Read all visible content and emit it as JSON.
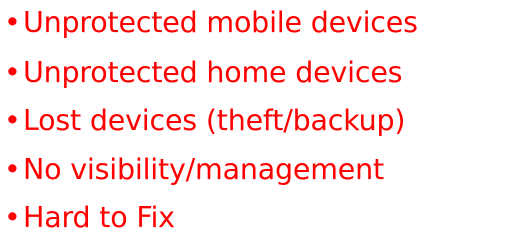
{
  "bullet_symbol": "•",
  "text_color": "#ff0000",
  "items": [
    "Unprotected mobile devices",
    "Unprotected home devices",
    "Lost devices (theft/backup)",
    "No visibility/management",
    "Hard to Fix"
  ]
}
